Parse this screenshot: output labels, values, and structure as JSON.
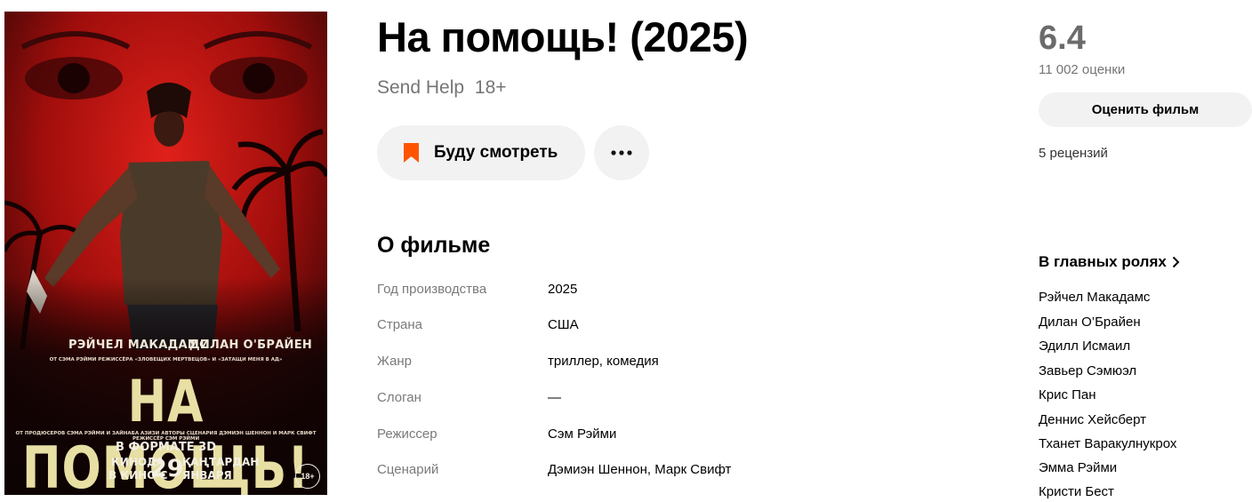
{
  "poster": {
    "actor_left": "РЭЙЧЕЛ МАКАДАМС",
    "actor_right": "ДИЛАН О'БРАЙЕН",
    "credits_top": "ОТ СЭМА РЭЙМИ РЕЖИССЁРА «ЗЛОВЕЩИХ МЕРТВЕЦОВ» И «ЗАТАЩИ МЕНЯ В АД»",
    "title": "НА ПОМОЩЬ!",
    "credits_bottom": "ОТ ПРОДЮСЕРОВ СЭМА РЭЙМИ И ЗАЙНАБА АЗИЗИ  АВТОРЫ СЦЕНАРИЯ ДЭМИЭН ШЕННОН И МАРК СВИФТ  РЕЖИССЁР СЭМ РЭЙМИ",
    "format": "В ФОРМАТЕ 3D",
    "release_line1": "КИНОДА",
    "release_line2": "В КИНО С",
    "release_day": "29",
    "release_month1": "ҚАҢТАРДАН",
    "release_month2": "ЯНВАРЯ",
    "age_badge": "18+"
  },
  "film": {
    "title": "На помощь! (2025)",
    "original_title": "Send Help",
    "age_rating": "18+"
  },
  "actions": {
    "watch_label": "Буду смотреть",
    "bookmark_color": "#ff5500"
  },
  "about": {
    "heading": "О фильме",
    "rows": [
      {
        "key": "Год производства",
        "value": "2025"
      },
      {
        "key": "Страна",
        "value": "США"
      },
      {
        "key": "Жанр",
        "value": "триллер, комедия"
      },
      {
        "key": "Слоган",
        "value": "—"
      },
      {
        "key": "Режиссер",
        "value": "Сэм Рэйми"
      },
      {
        "key": "Сценарий",
        "value": "Дэмиэн Шеннон, Марк Свифт"
      }
    ]
  },
  "rating": {
    "score": "6.4",
    "votes": "11 002 оценки",
    "rate_button": "Оценить фильм",
    "reviews": "5 рецензий"
  },
  "cast": {
    "heading": "В главных ролях",
    "items": [
      "Рэйчел Макадамс",
      "Дилан О’Брайен",
      "Эдилл Исмаил",
      "Завьер Сэмюэл",
      "Крис Пан",
      "Деннис Хейсберт",
      "Тханет Варакулнукрох",
      "Эмма Рэйми",
      "Кристи Бест"
    ]
  }
}
